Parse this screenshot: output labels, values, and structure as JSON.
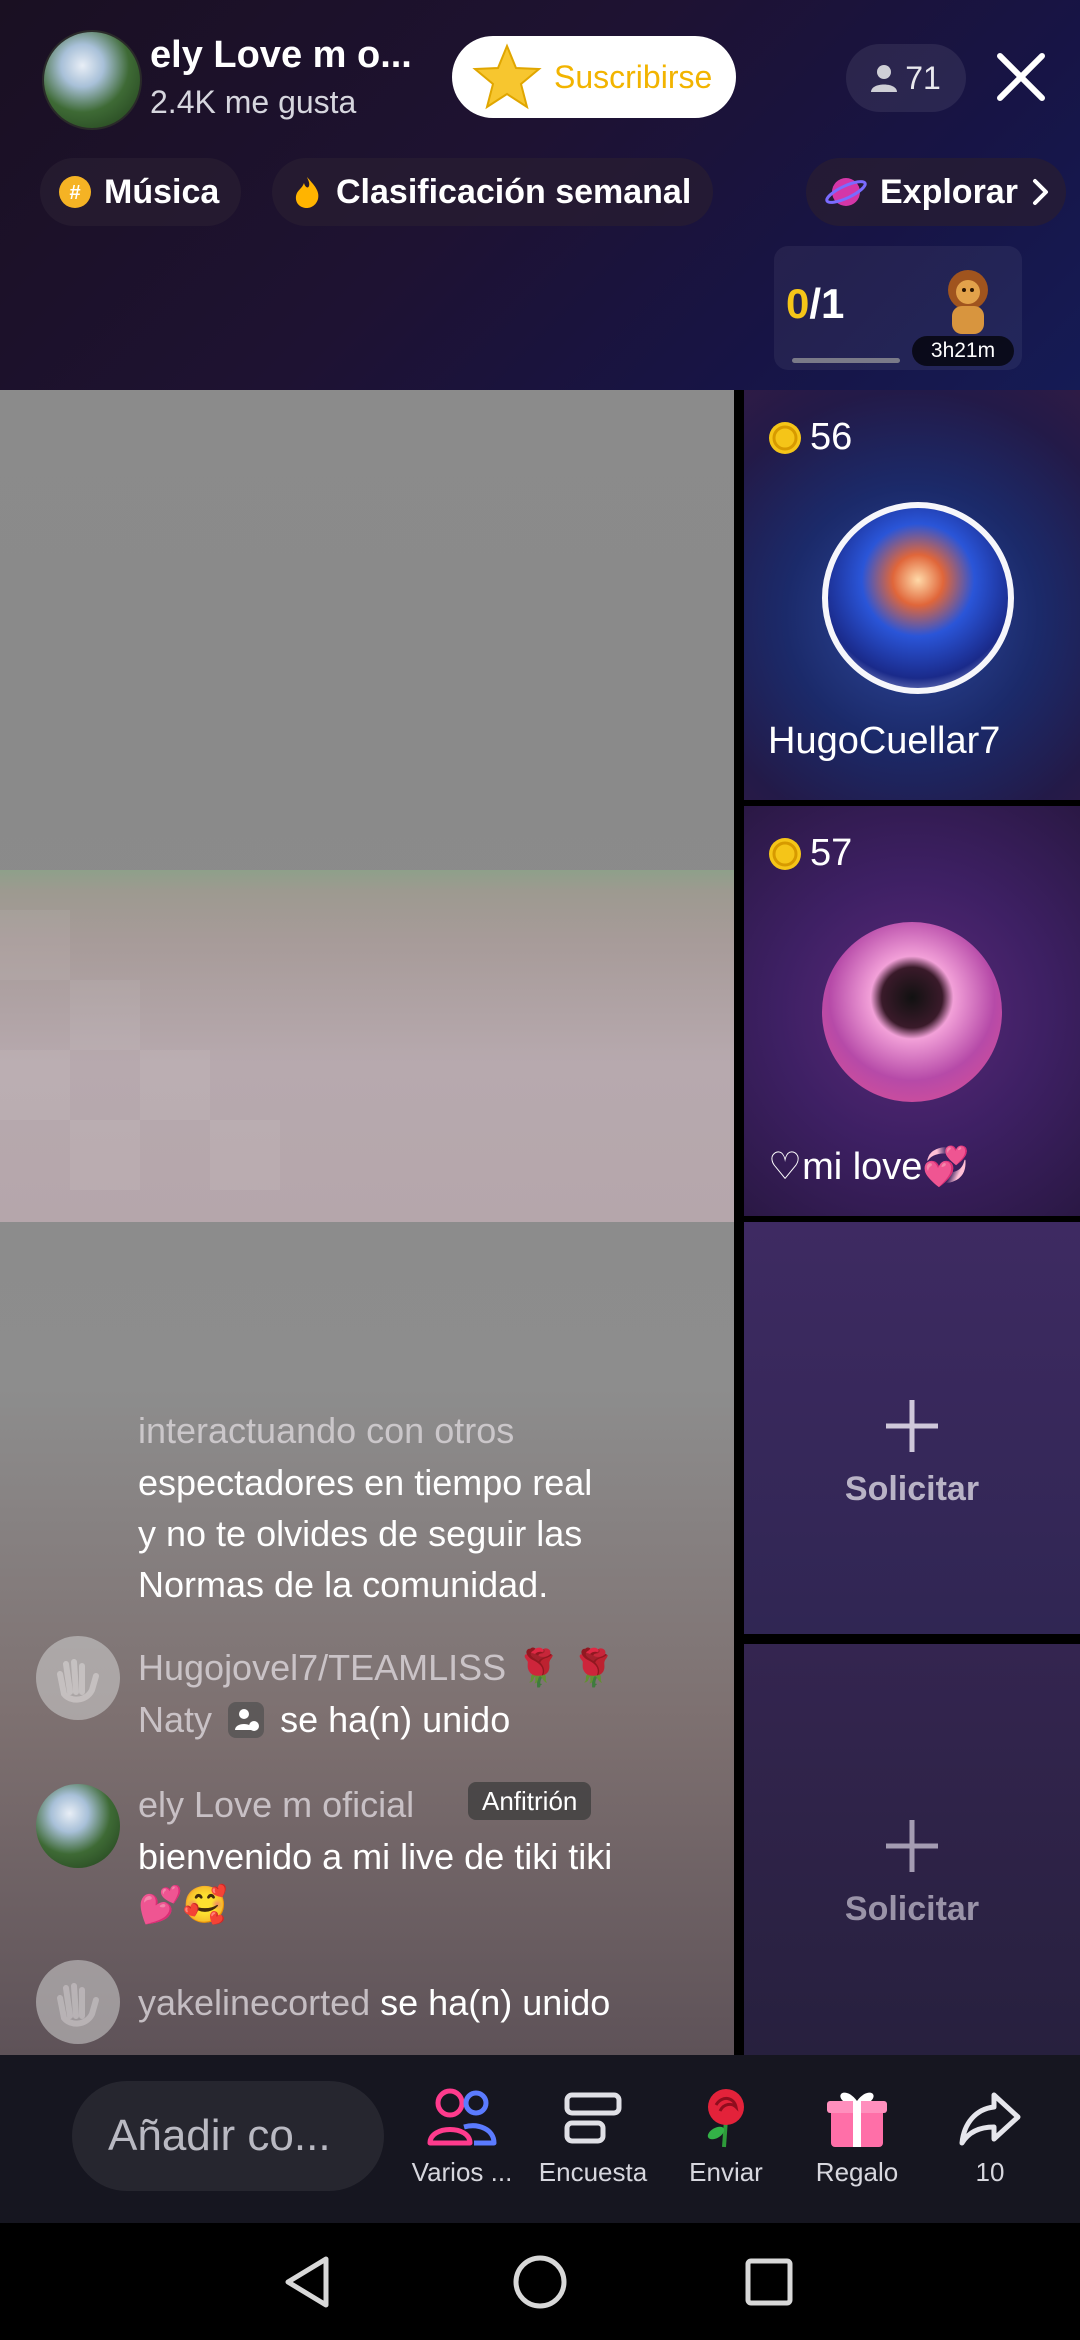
{
  "header": {
    "host_name": "ely Love m o...",
    "likes": "2.4K me gusta",
    "subscribe_label": "Suscribirse",
    "viewer_count": "71"
  },
  "chips": [
    {
      "label": "Música",
      "icon": "hashtag-badge-icon"
    },
    {
      "label": "Clasificación semanal",
      "icon": "flame-icon"
    },
    {
      "label": "Explorar",
      "icon": "planet-icon"
    }
  ],
  "score": {
    "current": "0",
    "total": "/1",
    "timer": "3h21m"
  },
  "guests": [
    {
      "coins": "56",
      "name": "HugoCuellar7"
    },
    {
      "coins": "57",
      "name": "♡mi love💞"
    }
  ],
  "request_slots": [
    {
      "label": "Solicitar"
    },
    {
      "label": "Solicitar"
    }
  ],
  "chat": {
    "notice_line1": "interactuando con otros",
    "notice_line2": "espectadores en tiempo real",
    "notice_line3": "y no te olvides de seguir las",
    "notice_line4": "Normas de la comunidad.",
    "join1_users": "Hugojovel7/TEAMLISS 🌹 🌹",
    "join1_second_user": "Naty",
    "join1_text": "se ha(n) unido",
    "host_msg_user": "ely Love m oficial",
    "host_badge": "Anfitrión",
    "host_msg_line1": "bienvenido a mi live de tiki tiki",
    "host_msg_line2": "💕🥰",
    "join2_user": "yakelinecorted",
    "join2_text": "se ha(n) unido"
  },
  "action_bar": {
    "comment_placeholder": "Añadir co...",
    "multi_label": "Varios ...",
    "poll_label": "Encuesta",
    "send_label": "Enviar",
    "gift_label": "Regalo",
    "share_label": "10"
  },
  "colors": {
    "accent_yellow": "#f5c518",
    "subscribe_text": "#f2b400",
    "multi_pink": "#ff3b8d"
  }
}
